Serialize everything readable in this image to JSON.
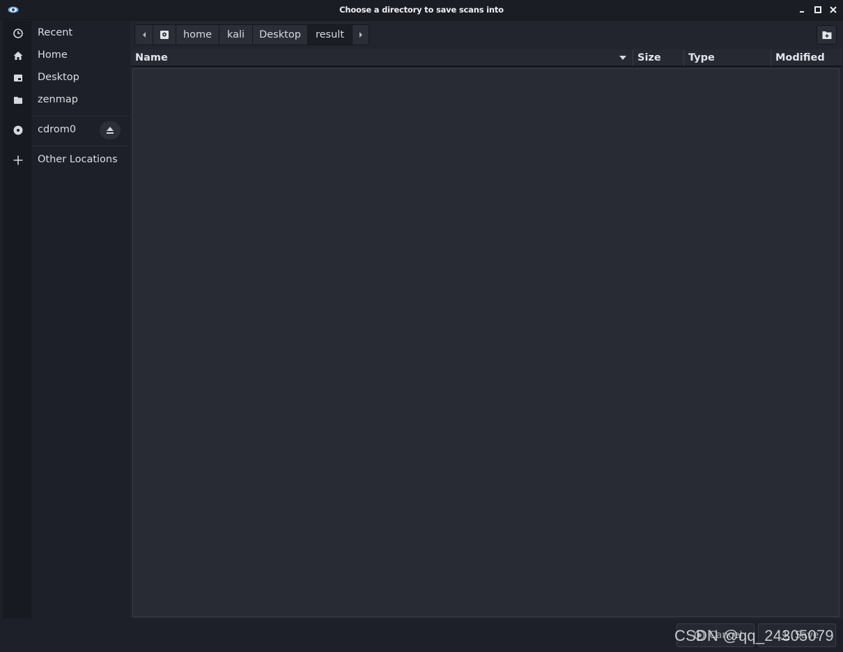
{
  "window": {
    "title": "Choose a directory to save scans into"
  },
  "sidebar": {
    "items": [
      {
        "label": "Recent",
        "icon": "clock-icon"
      },
      {
        "label": "Home",
        "icon": "home-icon"
      },
      {
        "label": "Desktop",
        "icon": "desktop-icon"
      },
      {
        "label": "zenmap",
        "icon": "folder-icon"
      }
    ],
    "devices": [
      {
        "label": "cdrom0",
        "icon": "disc-icon"
      }
    ],
    "other": {
      "label": "Other Locations",
      "icon": "plus-icon"
    }
  },
  "pathbar": {
    "segments": [
      {
        "label": "home"
      },
      {
        "label": "kali"
      },
      {
        "label": "Desktop"
      },
      {
        "label": "result",
        "active": true
      }
    ]
  },
  "columns": {
    "name": "Name",
    "size": "Size",
    "type": "Type",
    "modified": "Modified"
  },
  "buttons": {
    "cancel": "Cancel",
    "save": "Save"
  },
  "watermark": "CSDN @qq_24305079",
  "colors": {
    "background": "#23252e",
    "rail": "#181a21",
    "list": "#282a34",
    "text": "#dcdee4"
  }
}
